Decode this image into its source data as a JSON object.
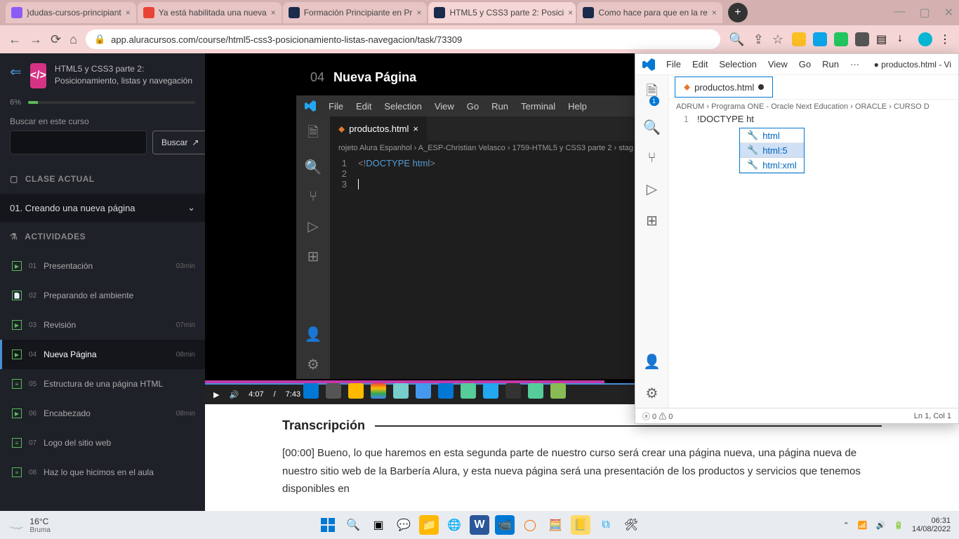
{
  "browser": {
    "tabs": [
      {
        "title": "}dudas-cursos-principiant",
        "favicon": "#8b5cf6"
      },
      {
        "title": "Ya está habilitada una nueva",
        "favicon": "#ea4335"
      },
      {
        "title": "Formación Principiante en Pr",
        "favicon": "#1a2b4c"
      },
      {
        "title": "HTML5 y CSS3 parte 2: Posici",
        "favicon": "#1a2b4c",
        "active": true
      },
      {
        "title": "Como hace para que en la re",
        "favicon": "#1a2b4c"
      }
    ],
    "url": "app.aluracursos.com/course/html5-css3-posicionamiento-listas-navegacion/task/73309"
  },
  "sidebar": {
    "course_title": "HTML5 y CSS3 parte 2: Posicionamiento, listas y navegación",
    "progress": "6%",
    "search_label": "Buscar en este curso",
    "search_btn": "Buscar",
    "section_current": "CLASE ACTUAL",
    "current_lesson": "01. Creando una nueva página",
    "section_activities": "ACTIVIDADES",
    "activities": [
      {
        "num": "01",
        "title": "Presentación",
        "time": "03min",
        "icon": "▶"
      },
      {
        "num": "02",
        "title": "Preparando el ambiente",
        "time": "",
        "icon": "📄"
      },
      {
        "num": "03",
        "title": "Revisión",
        "time": "07min",
        "icon": "▶"
      },
      {
        "num": "04",
        "title": "Nueva Página",
        "time": "08min",
        "icon": "▶",
        "active": true
      },
      {
        "num": "05",
        "title": "Estructura de una página HTML",
        "time": "",
        "icon": "≡"
      },
      {
        "num": "06",
        "title": "Encabezado",
        "time": "08min",
        "icon": "▶"
      },
      {
        "num": "07",
        "title": "Logo del sitio web",
        "time": "",
        "icon": "≡"
      },
      {
        "num": "08",
        "title": "Haz lo que hicimos en el aula",
        "time": "",
        "icon": "≡"
      }
    ]
  },
  "lesson": {
    "num": "04",
    "title": "Nueva Página"
  },
  "vscode_inner": {
    "menu": [
      "File",
      "Edit",
      "Selection",
      "View",
      "Go",
      "Run",
      "Terminal",
      "Help"
    ],
    "filename": "productos.h",
    "tab": "productos.html",
    "breadcrumbs": "rojeto Alura Espanhol › A_ESP-Christian Velasco › 1759-HTML5 y CSS3 parte 2 › stag",
    "doctype_open": "<!",
    "doctype_kw": "DOCTYPE html",
    "doctype_close": ">"
  },
  "video": {
    "current": "4:07",
    "total": "7:43"
  },
  "transcript": {
    "heading": "Transcripción",
    "text": "[00:00] Bueno, lo que haremos en esta segunda parte de nuestro curso será crear una página nueva, una página nueva de nuestro sitio web de la Barbería Alura, y esta nueva página será una presentación de los productos y servicios que tenemos disponibles en"
  },
  "vscode_window": {
    "menu": [
      "File",
      "Edit",
      "Selection",
      "View",
      "Go",
      "Run"
    ],
    "dots": "···",
    "filename": "● productos.html - Vi",
    "tab": "productos.html",
    "breadcrumbs": "ADRUM › Programa ONE - Oracle Next Education › ORACLE › CURSO D",
    "line1": "!DOCTYPE ht",
    "suggestions": [
      "html",
      "html:5",
      "html:xml"
    ],
    "status_left": "ⓧ 0 ⚠ 0",
    "status_right": "Ln 1, Col 1",
    "badge": "1"
  },
  "taskbar": {
    "temp": "16°C",
    "weather": "Bruma",
    "time": "06:31",
    "date": "14/08/2022"
  }
}
